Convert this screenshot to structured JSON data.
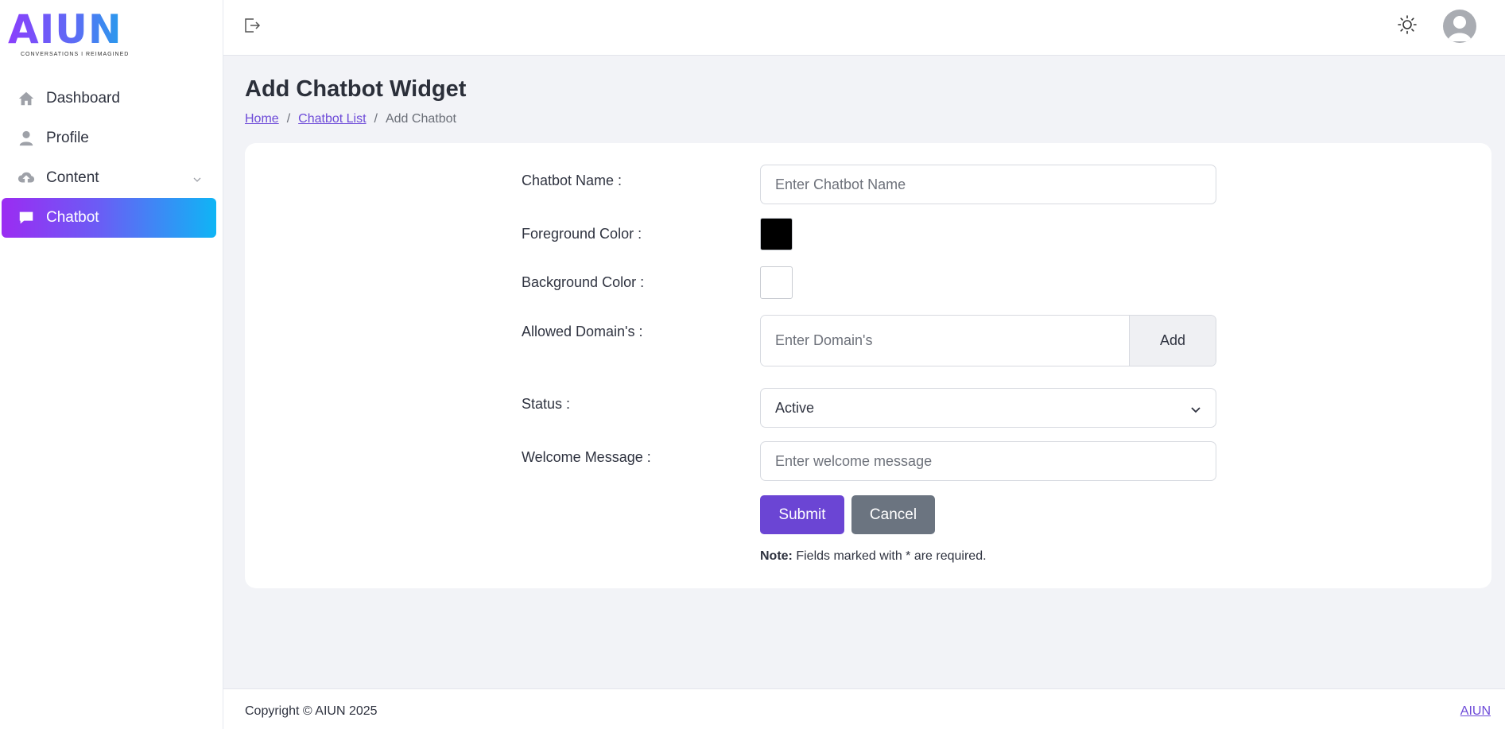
{
  "brand": {
    "logo_text": "AIUN",
    "tagline": "CONVERSATIONS  I  REIMAGINED"
  },
  "sidebar": {
    "items": [
      {
        "label": "Dashboard",
        "icon": "home-icon"
      },
      {
        "label": "Profile",
        "icon": "user-icon"
      },
      {
        "label": "Content",
        "icon": "cloud-upload-icon"
      },
      {
        "label": "Chatbot",
        "icon": "chat-icon"
      }
    ],
    "active": "Chatbot"
  },
  "page": {
    "title": "Add Chatbot Widget",
    "breadcrumb": {
      "home": "Home",
      "sep": "/",
      "list": "Chatbot List",
      "current": "Add Chatbot"
    }
  },
  "form": {
    "name_label": "Chatbot Name :",
    "name_placeholder": "Enter Chatbot Name",
    "fg_label": "Foreground Color :",
    "fg_color": "#000000",
    "bg_label": "Background Color :",
    "bg_color": "#ffffff",
    "domain_label": "Allowed Domain's :",
    "domain_placeholder": "Enter Domain's",
    "add_label": "Add",
    "status_label": "Status :",
    "status_value": "Active",
    "welcome_label": "Welcome Message :",
    "welcome_placeholder": "Enter welcome message",
    "submit_label": "Submit",
    "cancel_label": "Cancel",
    "note_bold": "Note:",
    "note_text": " Fields marked with * are required."
  },
  "footer": {
    "copyright": "Copyright © AIUN 2025",
    "link": "AIUN"
  },
  "colors": {
    "accent": "#6b45d4",
    "active_gradient_start": "#9b2cf2",
    "active_gradient_end": "#0fb5f5",
    "cancel": "#6b7480"
  }
}
